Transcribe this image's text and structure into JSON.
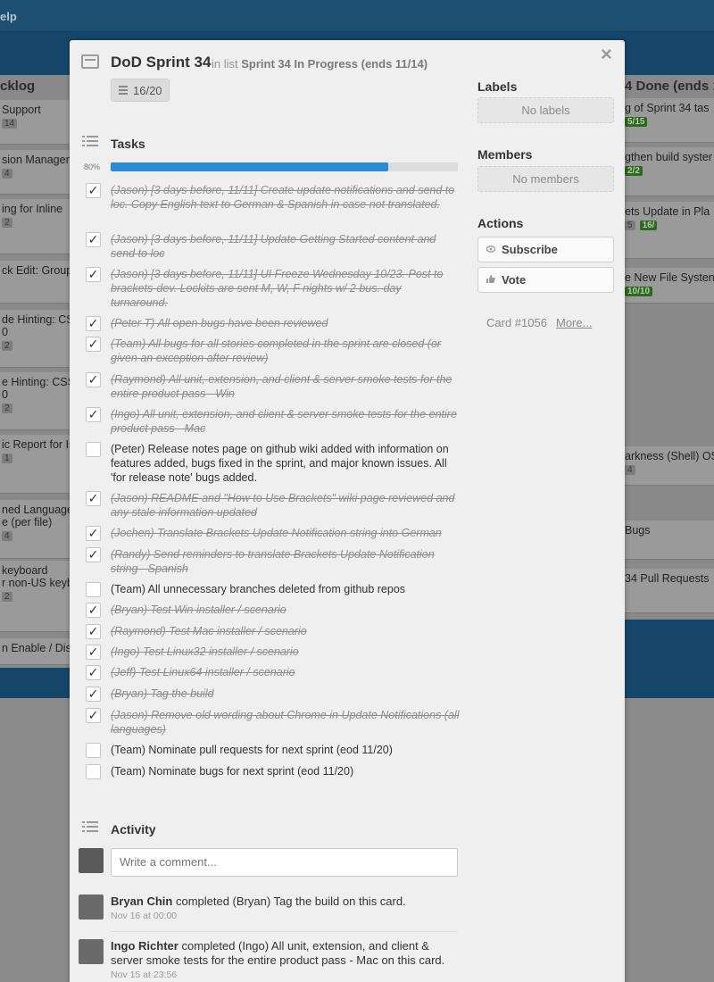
{
  "background": {
    "help_text": "elp",
    "left_list": {
      "title": "cklog",
      "cards": [
        {
          "text": "Support",
          "badge": "14"
        },
        {
          "text": "sion Managem",
          "badge": "4"
        },
        {
          "text": "ing for Inline",
          "badge": "2"
        },
        {
          "text": "ck Edit: Group",
          "badge": ""
        },
        {
          "text": "de Hinting: CS",
          "line2": "0",
          "badge": "2"
        },
        {
          "text": "e Hinting: CSS",
          "line2": "0",
          "badge": "2"
        },
        {
          "text": "ic Report for Is",
          "badge": "1"
        },
        {
          "text": "ned Language",
          "line2": "e (per file)",
          "badge": "4"
        },
        {
          "text": " keyboard",
          "line2": "r non-US keyb",
          "badge": "2"
        },
        {
          "text": "n Enable / Dis",
          "badge": ""
        }
      ]
    },
    "right_list": {
      "title": "4 Done (ends 11",
      "cards": [
        {
          "text": "g of Sprint 34 tas",
          "badge": "5/15"
        },
        {
          "text": "gthen build syster",
          "badge": "2/2"
        },
        {
          "text": "ets Update in Pla",
          "badge": "5",
          "green": "16/"
        },
        {
          "text": "e New File Systen",
          "badge": "10/10"
        },
        {
          "text": "arkness (Shell) OS",
          "badge": "4"
        },
        {
          "text": " Bugs",
          "badge": ""
        },
        {
          "text": "34 Pull Requests",
          "badge": ""
        }
      ]
    }
  },
  "card": {
    "title": "DoD Sprint 34",
    "in_list_prefix": "in list",
    "list_name": "Sprint 34 In Progress (ends 11/14)",
    "checklist_count": "16/20",
    "close_glyph": "×"
  },
  "tasks": {
    "heading": "Tasks",
    "progress_label": "80%",
    "progress_value": 0.8,
    "items": [
      {
        "text": "(Jason) [3 days before, 11/11] Create update notifications and send to loc. Copy English text to German & Spanish in case not translated.",
        "done": true
      },
      {
        "text": "(Jason) [3 days before, 11/11] Update Getting Started content and send to loc",
        "done": true
      },
      {
        "text": "(Jason) [3 days before, 11/11] UI Freeze Wednesday 10/23. Post to brackets-dev. Lockits are sent M, W, F nights w/ 2 bus. day turnaround.",
        "done": true
      },
      {
        "text": "(Peter T) All open bugs have been reviewed",
        "done": true
      },
      {
        "text": "(Team) All bugs for all stories completed in the sprint are closed (or given an exception after review)",
        "done": true
      },
      {
        "text": "(Raymond) All unit, extension, and client & server smoke tests for the entire product pass - Win",
        "done": true
      },
      {
        "text": "(Ingo) All unit, extension, and client & server smoke tests for the entire product pass - Mac",
        "done": true
      },
      {
        "text": "(Peter) Release notes page on github wiki added with information on features added, bugs fixed in the sprint, and major known issues. All 'for release note' bugs added.",
        "done": false
      },
      {
        "text": "(Jason) README and \"How to Use Brackets\" wiki page reviewed and any stale information updated",
        "done": true
      },
      {
        "text": "(Jochen) Translate Brackets Update Notification string into German",
        "done": true
      },
      {
        "text": "(Randy) Send reminders to translate Brackets Update Notification string - Spanish",
        "done": true
      },
      {
        "text": "(Team) All unnecessary branches deleted from github repos",
        "done": false
      },
      {
        "text": "(Bryan) Test Win installer / scenario",
        "done": true
      },
      {
        "text": "(Raymond) Test Mac installer / scenario",
        "done": true
      },
      {
        "text": "(Ingo) Test Linux32 installer / scenario",
        "done": true
      },
      {
        "text": "(Jeff) Test Linux64 installer / scenario",
        "done": true
      },
      {
        "text": "(Bryan) Tag the build",
        "done": true
      },
      {
        "text": "(Jason) Remove old wording about Chrome in Update Notifications (all languages)",
        "done": true
      },
      {
        "text": "(Team) Nominate pull requests for next sprint (eod 11/20)",
        "done": false
      },
      {
        "text": "(Team) Nominate bugs for next sprint (eod 11/20)",
        "done": false
      }
    ]
  },
  "activity": {
    "heading": "Activity",
    "comment_placeholder": "Write a comment...",
    "entries": [
      {
        "user": "Bryan Chin",
        "action": "completed (Bryan) Tag the build on this card.",
        "time": "Nov 16 at 00:00"
      },
      {
        "user": "Ingo Richter",
        "action": "completed (Ingo) All unit, extension, and client & server smoke tests for the entire product pass - Mac on this card.",
        "time": "Nov 15 at 23:56"
      }
    ]
  },
  "sidebar": {
    "labels_heading": "Labels",
    "labels_empty": "No labels",
    "members_heading": "Members",
    "members_empty": "No members",
    "actions_heading": "Actions",
    "subscribe_label": "Subscribe",
    "vote_label": "Vote",
    "card_number": "Card #1056",
    "more_label": "More..."
  },
  "colors": {
    "progress_fill": "#2c8bd4",
    "board_blue": "#16476a",
    "modal_bg": "#efefef",
    "label_green": "#2b6a1f"
  },
  "icons": {
    "card": "card-icon",
    "checklist": "checklist-icon",
    "activity": "activity-icon",
    "subscribe": "eye-icon",
    "vote": "thumbs-up-icon",
    "close": "close-icon"
  }
}
